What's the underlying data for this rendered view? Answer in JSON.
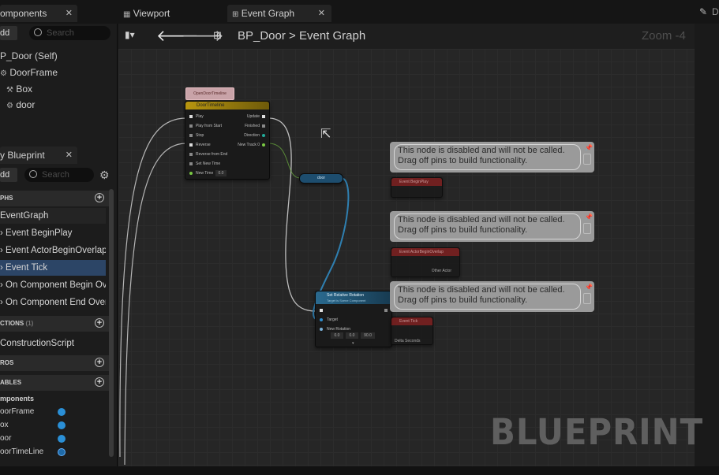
{
  "left_top_panel": {
    "tab_label": "omponents",
    "add_label": "dd",
    "search_placeholder": "Search",
    "tree": [
      "P_Door (Self)",
      "DoorFrame",
      "Box",
      "door"
    ]
  },
  "left_bottom_panel": {
    "tab_label": "y Blueprint",
    "add_label": "dd",
    "search_placeholder": "Search",
    "sections": {
      "graphs": "PHS",
      "functions": "CTIONS",
      "functions_count": "(1)",
      "macros": "ROS",
      "variables": "ABLES"
    },
    "graph_items": [
      "EventGraph",
      "Event BeginPlay",
      "Event ActorBeginOverlap",
      "Event Tick",
      "On Component Begin Ov",
      "On Component End Over"
    ],
    "function_items": [
      "ConstructionScript"
    ],
    "variables_header": "mponents",
    "variables": [
      "oorFrame",
      "ox",
      "oor",
      "oorTimeLine"
    ]
  },
  "doc_tabs": [
    "Viewport",
    "Event Graph"
  ],
  "toolbar": {
    "breadcrumb_root": "BP_Door",
    "breadcrumb_sep": ">",
    "breadcrumb_current": "Event Graph",
    "zoom": "Zoom -4"
  },
  "nodes": {
    "timeline_label": "OpenDoorTimeline",
    "timeline_title": "DoorTimeline",
    "timeline_inputs": [
      "Play",
      "Play from Start",
      "Stop",
      "Reverse",
      "Reverse from End",
      "Set New Time",
      "New Time"
    ],
    "timeline_new_time_value": "0.0",
    "timeline_outputs": [
      "Update",
      "Finished",
      "Direction",
      "New Track 0"
    ],
    "reroute_label": "door",
    "set_rotation_title": "Set Relative Rotation",
    "set_rotation_subtitle": "Target is Scene Component",
    "set_rotation_pins": [
      "Target",
      "New Rotation"
    ],
    "set_rotation_values": [
      "0.0",
      "0.0",
      "90.0"
    ],
    "disabled_nodes": [
      "Event BeginPlay",
      "Event ActorBeginOverlap",
      "Event Tick"
    ],
    "disabled_sub": [
      "",
      "Other Actor",
      "Delta Seconds"
    ]
  },
  "comments": [
    {
      "line1": "This node is disabled and will not be called.",
      "line2": "Drag off pins to build functionality."
    },
    {
      "line1": "This node is disabled and will not be called.",
      "line2": "Drag off pins to build functionality."
    },
    {
      "line1": "This node is disabled and will not be called.",
      "line2": "Drag off pins to build functionality."
    }
  ],
  "watermark": "BLUEPRINT",
  "right_strip_label": "D",
  "colors": {
    "graph_bg": "#262626",
    "selection_blue": "#2c4566",
    "timeline_header": "#b8960f",
    "exec_wire": "#d9d9d9",
    "object_wire": "#2f7fb0",
    "disabled_node_red": "#7d1f1f",
    "comment_bg": "#9a9a9a"
  },
  "icons": [
    "close-icon",
    "search-icon",
    "gear-icon",
    "plus-circle-icon",
    "pin-icon",
    "arrow-left-icon",
    "arrow-right-icon",
    "pencil-icon"
  ]
}
